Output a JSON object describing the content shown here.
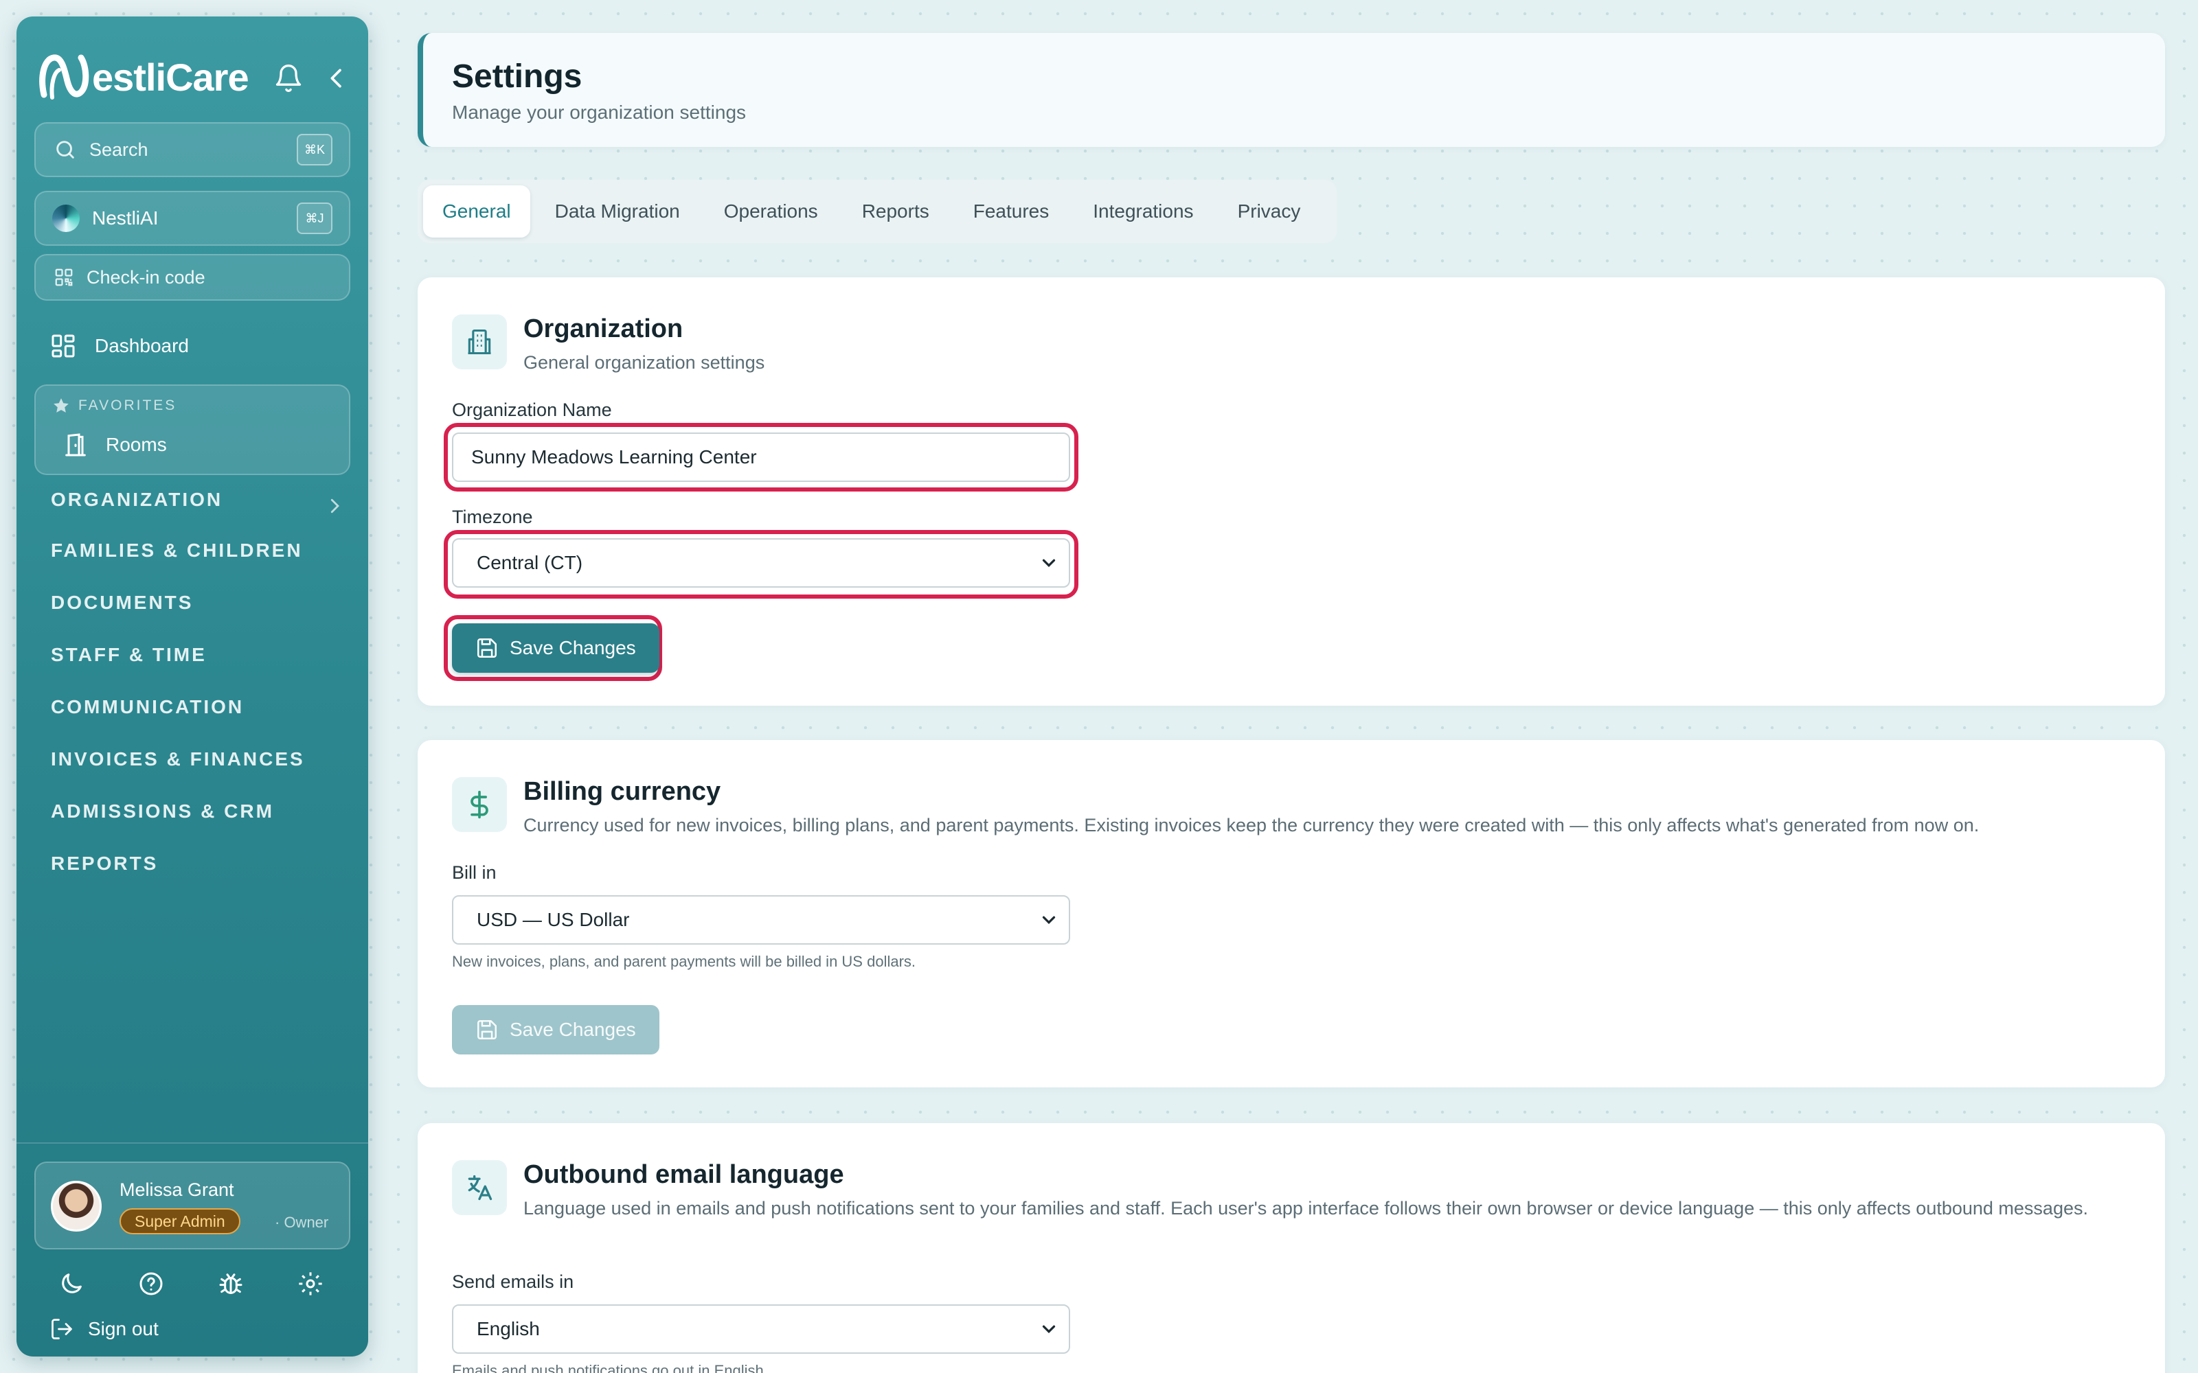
{
  "app": {
    "brand_prefix": "estli",
    "brand_suffix": "Care"
  },
  "sidebar": {
    "search_label": "Search",
    "search_shortcut": "⌘K",
    "ai_label": "NestliAI",
    "ai_shortcut": "⌘J",
    "checkin_label": "Check-in code",
    "dashboard_label": "Dashboard",
    "favorites_heading": "FAVORITES",
    "favorites_items": [
      "Rooms"
    ],
    "sections": [
      "ORGANIZATION",
      "FAMILIES & CHILDREN",
      "DOCUMENTS",
      "STAFF & TIME",
      "COMMUNICATION",
      "INVOICES & FINANCES",
      "ADMISSIONS & CRM",
      "REPORTS"
    ],
    "user": {
      "name": "Melissa Grant",
      "role_badge": "Super Admin",
      "role_suffix": "· Owner"
    },
    "signout_label": "Sign out"
  },
  "header": {
    "title": "Settings",
    "subtitle": "Manage your organization settings"
  },
  "tabs": [
    "General",
    "Data Migration",
    "Operations",
    "Reports",
    "Features",
    "Integrations",
    "Privacy"
  ],
  "active_tab": "General",
  "organization": {
    "title": "Organization",
    "description": "General organization settings",
    "name_label": "Organization Name",
    "name_value": "Sunny Meadows Learning Center",
    "timezone_label": "Timezone",
    "timezone_value": "Central (CT)",
    "save_label": "Save Changes"
  },
  "billing": {
    "title": "Billing currency",
    "description": "Currency used for new invoices, billing plans, and parent payments. Existing invoices keep the currency they were created with — this only affects what's generated from now on.",
    "bill_label": "Bill in",
    "bill_value": "USD — US Dollar",
    "help": "New invoices, plans, and parent payments will be billed in US dollars.",
    "save_label": "Save Changes"
  },
  "email_language": {
    "title": "Outbound email language",
    "description": "Language used in emails and push notifications sent to your families and staff. Each user's app interface follows their own browser or device language — this only affects outbound messages.",
    "send_label": "Send emails in",
    "send_value": "English",
    "help": "Emails and push notifications go out in English."
  },
  "colors": {
    "accent": "#2b7f89",
    "highlight": "#d7214e",
    "sidebar": "#2c8790"
  }
}
